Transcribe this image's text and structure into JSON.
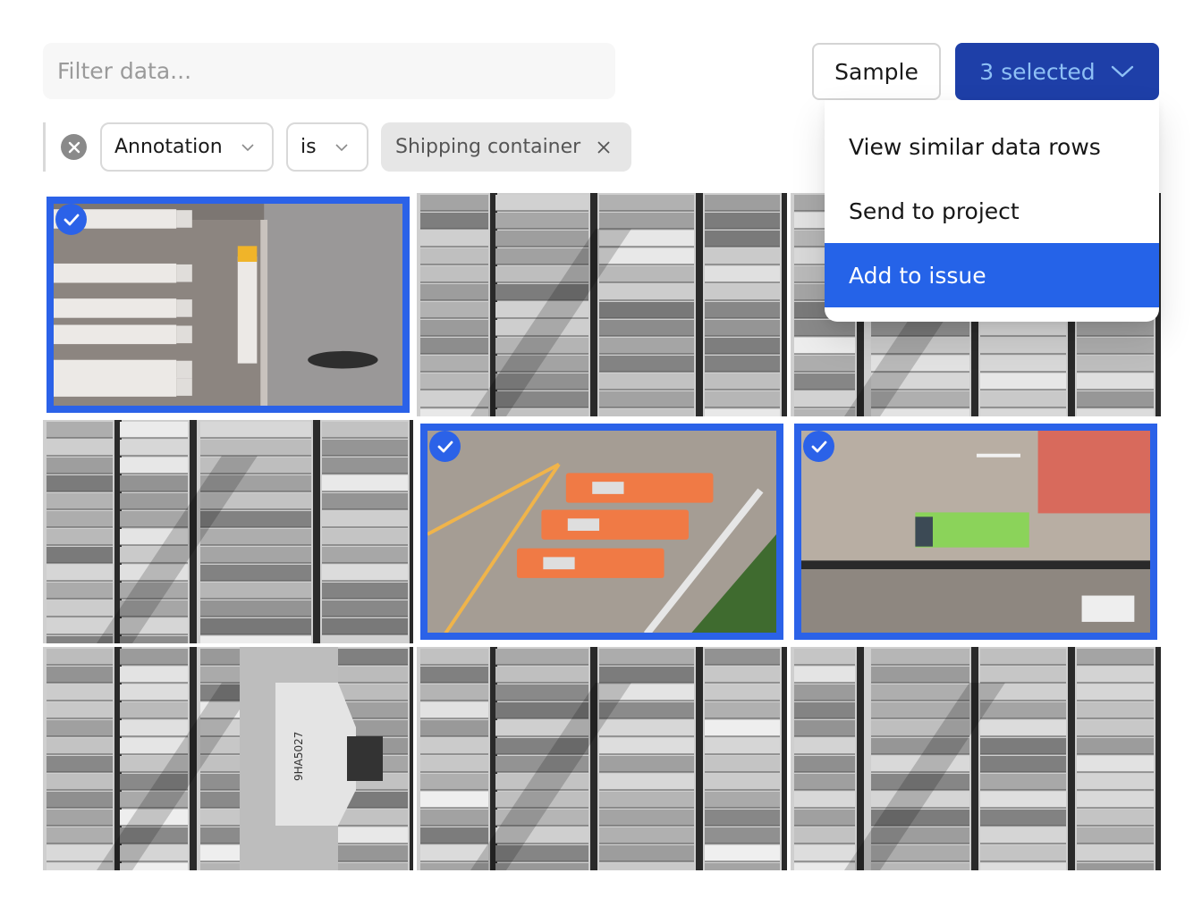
{
  "filter": {
    "placeholder": "Filter data...",
    "value": ""
  },
  "toolbar": {
    "sample_label": "Sample",
    "selected_label": "3 selected",
    "selected_count": 3
  },
  "active_filter": {
    "field": "Annotation",
    "operator": "is",
    "value": "Shipping container"
  },
  "dropdown": {
    "open": true,
    "items": [
      {
        "label": "View similar data rows",
        "highlighted": false
      },
      {
        "label": "Send to project",
        "highlighted": false
      },
      {
        "label": "Add to issue",
        "highlighted": true
      }
    ]
  },
  "grid": {
    "columns": 3,
    "tiles": [
      {
        "row": 1,
        "col": 1,
        "selected": true,
        "scene": "Aerial view of parked white semi-trailers and a yellow truck beside a warehouse roof",
        "style": "color"
      },
      {
        "row": 1,
        "col": 2,
        "selected": false,
        "scene": "Aerial grayscale view of stacked shipping containers",
        "style": "grayscale"
      },
      {
        "row": 1,
        "col": 3,
        "selected": false,
        "scene": "Aerial grayscale view of stacked shipping containers",
        "style": "grayscale"
      },
      {
        "row": 2,
        "col": 1,
        "selected": false,
        "scene": "Aerial grayscale view of stacked shipping containers",
        "style": "grayscale"
      },
      {
        "row": 2,
        "col": 2,
        "selected": true,
        "scene": "Aerial view of three orange buses in a parking lot",
        "style": "color"
      },
      {
        "row": 2,
        "col": 3,
        "selected": true,
        "scene": "Aerial view of a green truck and a white truck on a paved lot with red hatched zone",
        "style": "color"
      },
      {
        "row": 3,
        "col": 1,
        "selected": false,
        "scene": "Aerial grayscale view of container ship deck with hull marking",
        "style": "grayscale",
        "marking": "9HA5027"
      },
      {
        "row": 3,
        "col": 2,
        "selected": false,
        "scene": "Aerial grayscale view of stacked shipping containers",
        "style": "grayscale"
      },
      {
        "row": 3,
        "col": 3,
        "selected": false,
        "scene": "Aerial grayscale view of container ship stern with containers",
        "style": "grayscale"
      }
    ]
  },
  "colors": {
    "selection_border": "#2b62e8",
    "selected_button_bg": "#1e3fa8",
    "selected_button_text": "#8ec0f5",
    "menu_highlight": "#2563e8"
  }
}
